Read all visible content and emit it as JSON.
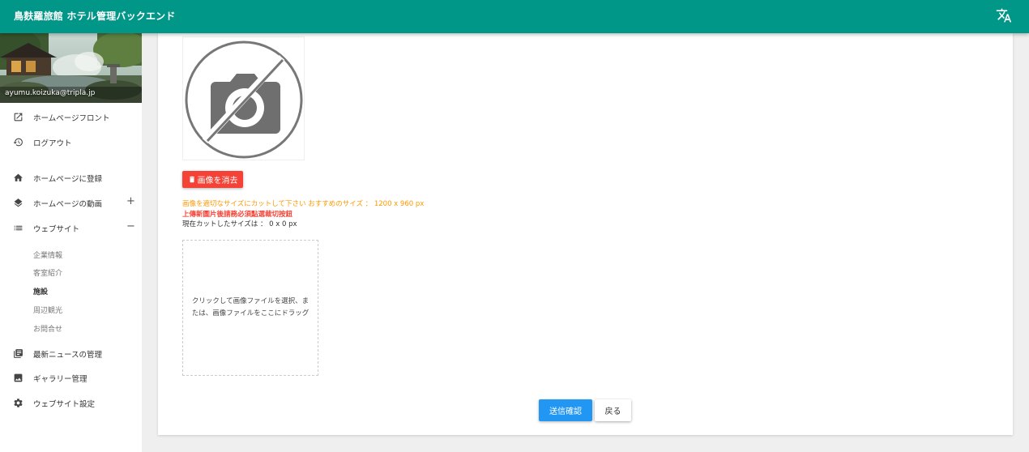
{
  "app": {
    "title": "鳥麸羅旅館 ホテル管理バックエンド",
    "translate_icon": "translate-icon"
  },
  "user": {
    "email": "ayumu.koizuka@tripla.jp"
  },
  "colors": {
    "primary": "#009688",
    "danger": "#f44336",
    "warning": "#ff9800",
    "info": "#2196f3"
  },
  "sidebar": {
    "items": [
      {
        "label": "ホームページフロント",
        "icon": "external-link-icon"
      },
      {
        "label": "ログアウト",
        "icon": "history-icon"
      },
      {
        "label": "ホームページに登録",
        "icon": "home-icon"
      },
      {
        "label": "ホームページの動画",
        "icon": "layers-icon",
        "toggle": "+"
      },
      {
        "label": "ウェブサイト",
        "icon": "list-icon",
        "toggle": "−"
      },
      {
        "label": "最新ニュースの管理",
        "icon": "library-books-icon"
      },
      {
        "label": "ギャラリー管理",
        "icon": "image-icon"
      },
      {
        "label": "ウェブサイト設定",
        "icon": "gear-icon"
      }
    ],
    "subitems": [
      "企業情報",
      "客室紹介",
      "施設",
      "周辺観光",
      "お問合せ"
    ],
    "active_subitem": "施設"
  },
  "form": {
    "delete_image_label": "画像を消去",
    "hint_size": "画像を適切なサイズにカットして下さい おすすめのサイズ ： 1200 x 960 px",
    "hint_crop": "上傳新圖片後請務必須點選裁切按鈕",
    "current_size": "現在カットしたサイズは ： 0 x 0 px",
    "dropzone_text": "クリックして画像ファイルを選択、または、画像ファイルをここにドラッグ",
    "submit_label": "送信確認",
    "back_label": "戻る"
  }
}
